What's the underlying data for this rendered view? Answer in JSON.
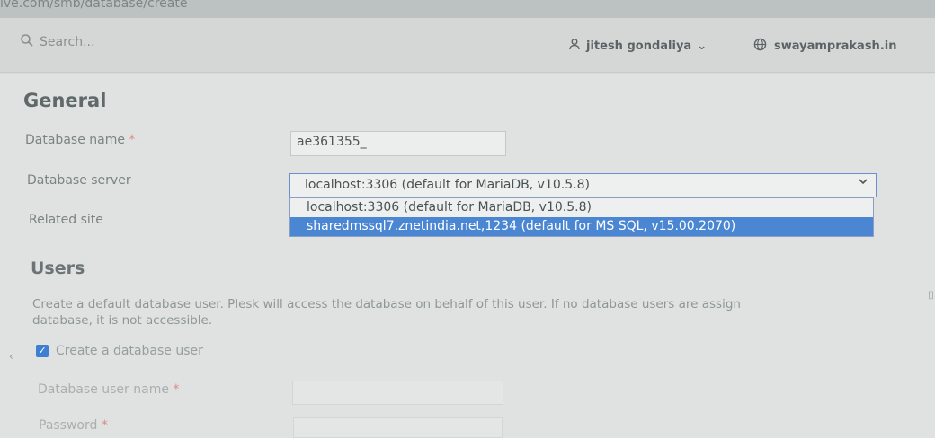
{
  "browser": {
    "url_fragment": "ive.com/smb/database/create"
  },
  "header": {
    "search_placeholder": "Search...",
    "user_name": "jitesh gondaliya",
    "user_chevron": "⌄",
    "site_name": "swayamprakash.in",
    "icons": {
      "search": "search-icon",
      "user": "user-icon",
      "globe": "globe-icon"
    }
  },
  "general": {
    "title": "General",
    "db_name_label": "Database name",
    "required_mark": "*",
    "db_name_value": "ae361355_",
    "db_server_label": "Database server",
    "db_server_selected": "localhost:3306 (default for MariaDB, v10.5.8)",
    "db_server_options": [
      "localhost:3306 (default for MariaDB, v10.5.8)",
      "sharedmssql7.znetindia.net,1234 (default for MS SQL, v15.00.2070)"
    ],
    "related_site_label": "Related site"
  },
  "users": {
    "title": "Users",
    "description_line1": "Create a default database user. Plesk will access the database on behalf of this user. If no database users are assign",
    "description_line2": "database, it is not accessible.",
    "create_user_label": "Create a database user",
    "create_user_checked": true,
    "user_name_label": "Database user name",
    "password_label": "Password"
  },
  "colors": {
    "accent": "#4a86d2",
    "required": "#d98a8a"
  }
}
